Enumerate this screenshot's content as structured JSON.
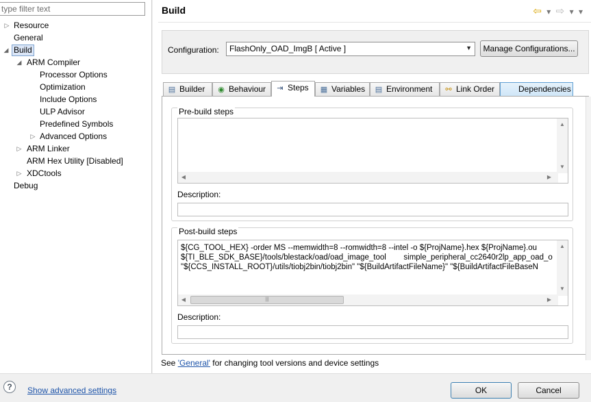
{
  "filter": {
    "placeholder": "type filter text"
  },
  "tree": [
    {
      "label": "Resource",
      "expander": "closed"
    },
    {
      "label": "General",
      "expander": ""
    },
    {
      "label": "Build",
      "expander": "open",
      "selected": true
    },
    {
      "label": "ARM Compiler",
      "expander": "open"
    },
    {
      "label": "Processor Options",
      "expander": ""
    },
    {
      "label": "Optimization",
      "expander": ""
    },
    {
      "label": "Include Options",
      "expander": ""
    },
    {
      "label": "ULP Advisor",
      "expander": ""
    },
    {
      "label": "Predefined Symbols",
      "expander": ""
    },
    {
      "label": "Advanced Options",
      "expander": "closed"
    },
    {
      "label": "ARM Linker",
      "expander": "closed"
    },
    {
      "label": "ARM Hex Utility  [Disabled]",
      "expander": ""
    },
    {
      "label": "XDCtools",
      "expander": "closed"
    },
    {
      "label": "Debug",
      "expander": ""
    }
  ],
  "page": {
    "title": "Build"
  },
  "configuration": {
    "label": "Configuration:",
    "value": "FlashOnly_OAD_ImgB  [ Active ]",
    "manage_label": "Manage Configurations..."
  },
  "tabs": [
    {
      "label": "Builder",
      "icon": "builder-icon"
    },
    {
      "label": "Behaviour",
      "icon": "behaviour-icon"
    },
    {
      "label": "Steps",
      "icon": "steps-icon",
      "active": true
    },
    {
      "label": "Variables",
      "icon": "variables-icon"
    },
    {
      "label": "Environment",
      "icon": "environment-icon"
    },
    {
      "label": "Link Order",
      "icon": "link-order-icon"
    },
    {
      "label": "Dependencies",
      "icon": ""
    }
  ],
  "prebuild": {
    "title": "Pre-build steps",
    "description_label": "Description:"
  },
  "postbuild": {
    "title": "Post-build steps",
    "lines": [
      "${CG_TOOL_HEX} -order MS --memwidth=8 --romwidth=8 --intel -o ${ProjName}.hex ${ProjName}.ou",
      "${TI_BLE_SDK_BASE}/tools/blestack/oad/oad_image_tool        simple_peripheral_cc2640r2lp_app_oad_o",
      "\"${CCS_INSTALL_ROOT}/utils/tiobj2bin/tiobj2bin\" \"${BuildArtifactFileName}\" \"${BuildArtifactFileBaseN"
    ],
    "description_label": "Description:"
  },
  "hint": {
    "prefix": "See ",
    "link": "'General'",
    "suffix": " for changing tool versions and device settings"
  },
  "footer": {
    "advanced_link": "Show advanced settings",
    "ok_label": "OK",
    "cancel_label": "Cancel"
  },
  "colors": {
    "link": "#1b52a8",
    "selection": "#dbe6f7",
    "tab_dependencies": "#cfe6f8"
  }
}
